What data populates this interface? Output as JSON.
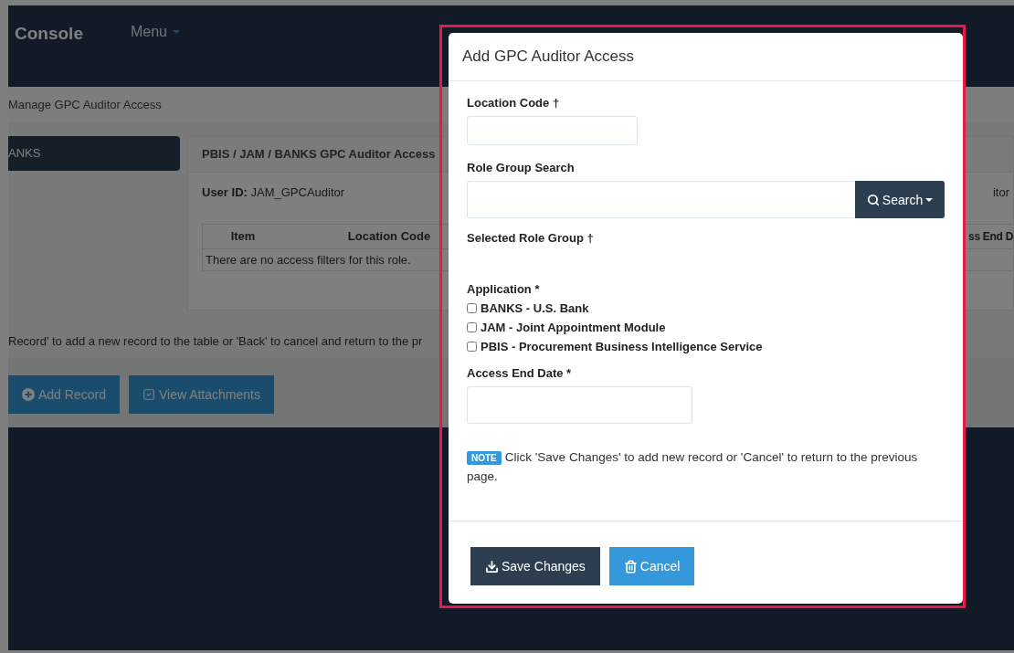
{
  "navbar": {
    "brand": "Console",
    "menu": "Menu"
  },
  "breadcrumb": "Manage GPC Auditor Access",
  "sidebar": {
    "items": [
      {
        "label": "ANKS",
        "selected": true
      }
    ]
  },
  "panel": {
    "title": "PBIS / JAM / BANKS GPC Auditor Access",
    "user_id_label": "User ID:",
    "user_id": "JAM_GPCAuditor",
    "right_text": "itor",
    "table": {
      "columns": [
        "Item",
        "Location Code",
        "ss End D"
      ],
      "empty_message": "There are no access filters for this role."
    }
  },
  "instruction": "Record' to add a new record to the table or 'Back' to cancel and return to the pr",
  "actions": [
    {
      "label": "Add Record",
      "kind": "add"
    },
    {
      "label": "View Attachments",
      "kind": "attachments"
    }
  ],
  "modal": {
    "title": "Add GPC Auditor Access",
    "location_code": {
      "label": "Location Code †"
    },
    "role_group_search": {
      "label": "Role Group Search",
      "button": "Search"
    },
    "selected_role_group": {
      "label": "Selected Role Group †"
    },
    "application": {
      "label": "Application *",
      "options": [
        {
          "label": "BANKS - U.S. Bank",
          "checked": false
        },
        {
          "label": "JAM - Joint Appointment Module",
          "checked": false
        },
        {
          "label": "PBIS - Procurement Business Intelligence Service",
          "checked": false
        }
      ]
    },
    "access_end_date": {
      "label": "Access End Date *"
    },
    "note": {
      "badge": "NOTE",
      "text": "Click 'Save Changes' to add new record or 'Cancel' to return to the previous page."
    },
    "buttons": [
      {
        "label": "Save Changes",
        "kind": "save"
      },
      {
        "label": "Cancel",
        "kind": "cancel"
      }
    ]
  }
}
